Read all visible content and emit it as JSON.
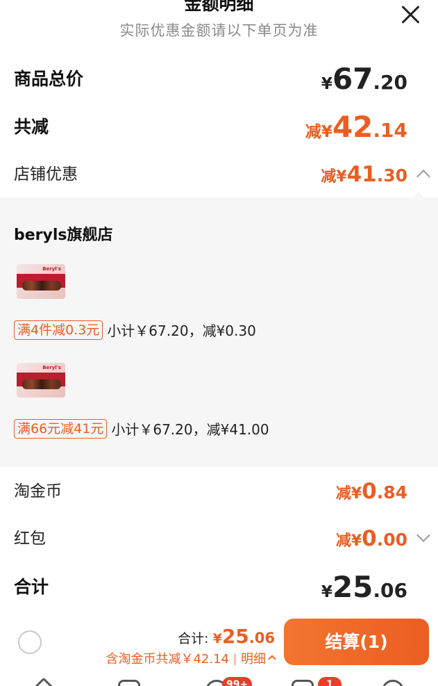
{
  "header": {
    "title": "金额明细",
    "subtitle": "实际优惠金额请以下单页为准"
  },
  "rows": {
    "total_goods": {
      "label": "商品总价",
      "currency": "¥",
      "int": "67",
      "dec": ".20"
    },
    "total_reduce": {
      "label": "共减",
      "prefix": "减¥",
      "int": "42",
      "dec": ".14"
    },
    "shop_discount": {
      "label": "店铺优惠",
      "prefix": "减¥",
      "int": "41",
      "dec": ".30"
    },
    "taobao_coins": {
      "label": "淘金币",
      "prefix": "减¥",
      "int": "0",
      "dec": ".84"
    },
    "red_packet": {
      "label": "红包",
      "prefix": "减¥",
      "int": "0",
      "dec": ".00"
    },
    "sum": {
      "label": "合计",
      "currency": "¥",
      "int": "25",
      "dec": ".06"
    }
  },
  "shop_panel": {
    "shop_name": "beryls旗舰店",
    "items": [
      {
        "brand": "Beryl's",
        "promo_tag": "满4件减0.3元",
        "promo_text": "小计￥67.20，减¥0.30"
      },
      {
        "brand": "Beryl's",
        "promo_tag": "满66元减41元",
        "promo_text": "小计￥67.20，减¥41.00"
      }
    ]
  },
  "bottom_bar": {
    "sum_label": "合计:",
    "sum_currency": "¥",
    "sum_int": "25",
    "sum_dec": ".06",
    "reduce_text": "含淘金币共减￥42.14",
    "detail_label": "明细",
    "checkout_label": "结算(1)"
  },
  "tabbar": {
    "badges": [
      "99+",
      "1"
    ]
  },
  "colors": {
    "accent": "#ec5d22",
    "panel_bg": "#f6f6f6"
  },
  "icons": [
    "close-icon",
    "chevron-up-icon",
    "chevron-down-icon",
    "radio-icon"
  ]
}
